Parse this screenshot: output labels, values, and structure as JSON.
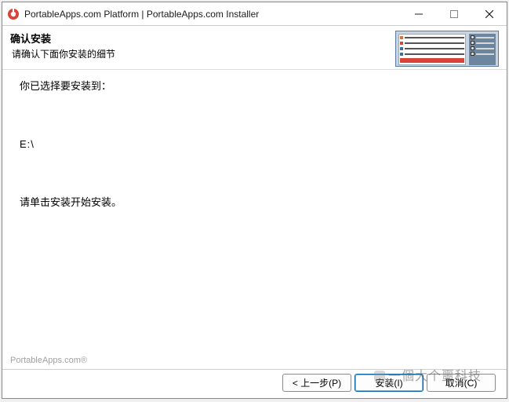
{
  "titlebar": {
    "title": "PortableApps.com Platform | PortableApps.com Installer"
  },
  "header": {
    "title": "确认安装",
    "subtitle": "请确认下面你安装的细节"
  },
  "content": {
    "chosen": "你已选择要安装到：",
    "path": "E:\\",
    "click_install": "请单击安装开始安装。"
  },
  "footer": {
    "brand": "PortableApps.com®",
    "back": "< 上一步(P)",
    "install": "安装(I)",
    "cancel": "取消(C)"
  },
  "watermark": "一個大个噩科技"
}
